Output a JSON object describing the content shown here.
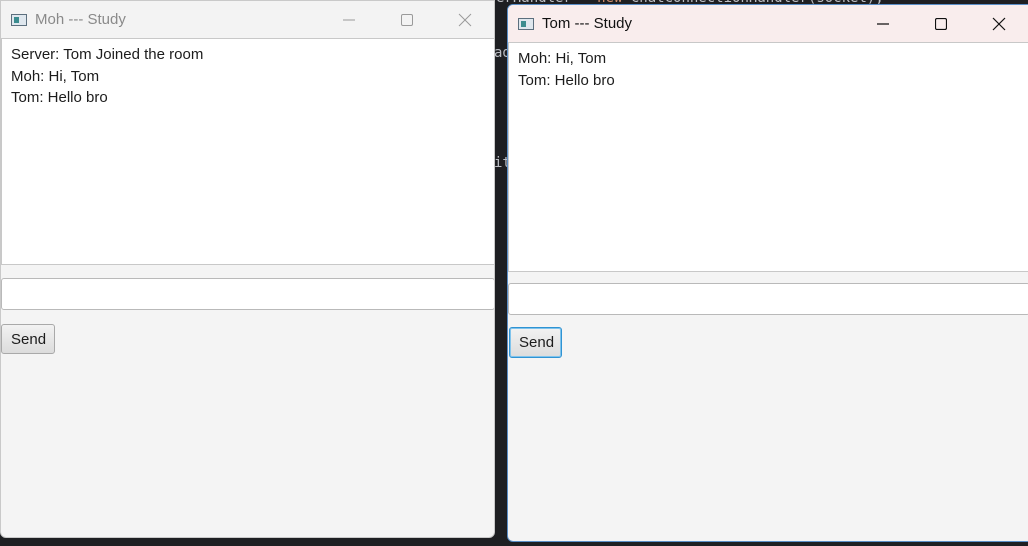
{
  "background_code": {
    "line1": "erHandler = new ChatConnectionHandler(socket);",
    "line1_kw": "new",
    "frag_ad": "ad",
    "frag_it": "it"
  },
  "windows": [
    {
      "title": "Moh --- Study",
      "messages": [
        "Server: Tom Joined the room",
        "Moh: Hi, Tom",
        "Tom: Hello bro"
      ],
      "input_value": "",
      "send_label": "Send",
      "focused": false
    },
    {
      "title": "Tom --- Study",
      "messages": [
        "Moh: Hi, Tom",
        "Tom: Hello bro"
      ],
      "input_value": "",
      "send_label": "Send",
      "focused": true
    }
  ],
  "icons": [
    "app-icon",
    "minimize-icon",
    "maximize-icon",
    "close-icon"
  ],
  "colors": {
    "focus_ring": "#2f93d3",
    "active_titlebar": "#f9eded",
    "inactive_title_text": "#8a8a8a"
  }
}
